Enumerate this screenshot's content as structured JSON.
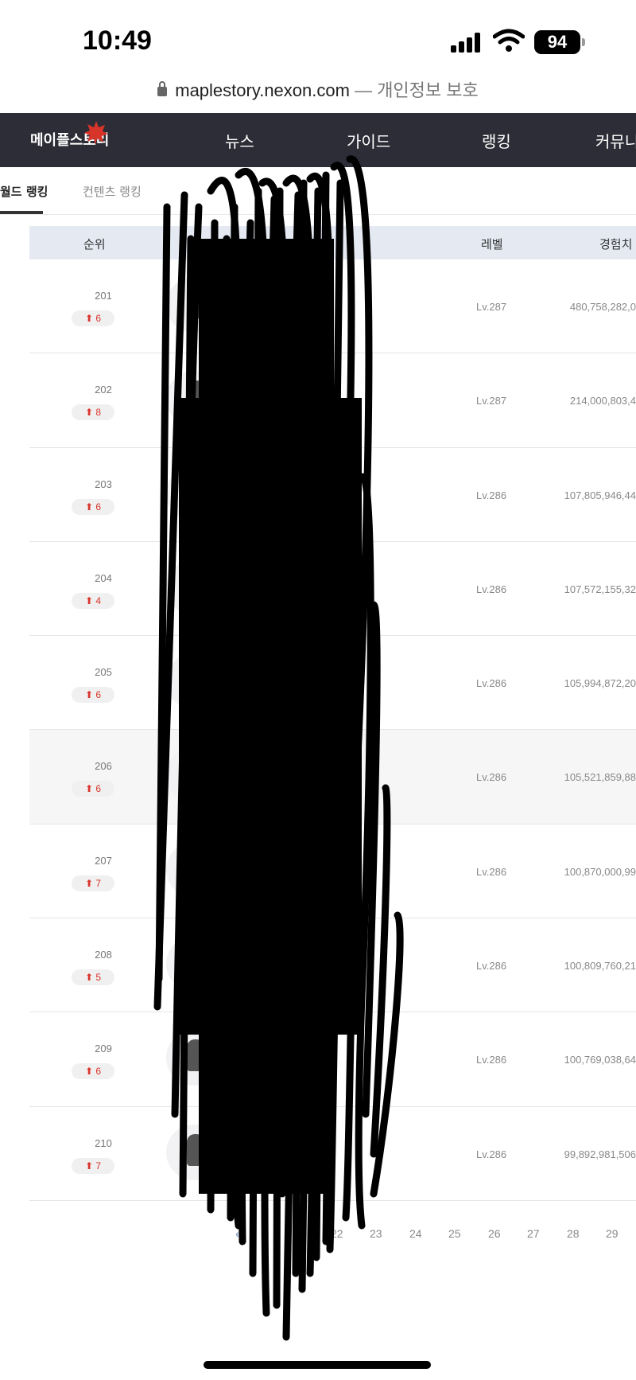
{
  "status_bar": {
    "time": "10:49",
    "battery": "94"
  },
  "browser": {
    "domain": "maplestory.nexon.com",
    "privacy_label": "— 개인정보 보호"
  },
  "site": {
    "logo_text": "메이플스토리",
    "nav": [
      "뉴스",
      "가이드",
      "랭킹",
      "커뮤니"
    ]
  },
  "tabs": [
    {
      "label": "월드 랭킹",
      "active": true
    },
    {
      "label": "컨텐츠 랭킹",
      "active": false
    }
  ],
  "table": {
    "headers": {
      "rank": "순위",
      "level": "레벨",
      "exp": "경험치"
    },
    "rows": [
      {
        "rank": "201",
        "change": "6",
        "level": "Lv.287",
        "exp": "480,758,282,0"
      },
      {
        "rank": "202",
        "change": "8",
        "level": "Lv.287",
        "exp": "214,000,803,4"
      },
      {
        "rank": "203",
        "change": "6",
        "level": "Lv.286",
        "exp": "107,805,946,44"
      },
      {
        "rank": "204",
        "change": "4",
        "level": "Lv.286",
        "exp": "107,572,155,32"
      },
      {
        "rank": "205",
        "change": "6",
        "level": "Lv.286",
        "exp": "105,994,872,20"
      },
      {
        "rank": "206",
        "change": "6",
        "level": "Lv.286",
        "exp": "105,521,859,88"
      },
      {
        "rank": "207",
        "change": "7",
        "level": "Lv.286",
        "exp": "100,870,000,99"
      },
      {
        "rank": "208",
        "change": "5",
        "level": "Lv.286",
        "exp": "100,809,760,21"
      },
      {
        "rank": "209",
        "change": "6",
        "level": "Lv.286",
        "exp": "100,769,038,64"
      },
      {
        "rank": "210",
        "change": "7",
        "level": "Lv.286",
        "exp": "99,892,981,506"
      }
    ]
  },
  "pagination": {
    "first": "«",
    "prev": "‹",
    "pages": [
      "22",
      "23",
      "24",
      "25",
      "26",
      "27",
      "28",
      "29"
    ]
  },
  "colors": {
    "nav_bg": "#2c2d36",
    "rank_up": "#d9342b",
    "table_head_bg": "#e4e9f2"
  }
}
